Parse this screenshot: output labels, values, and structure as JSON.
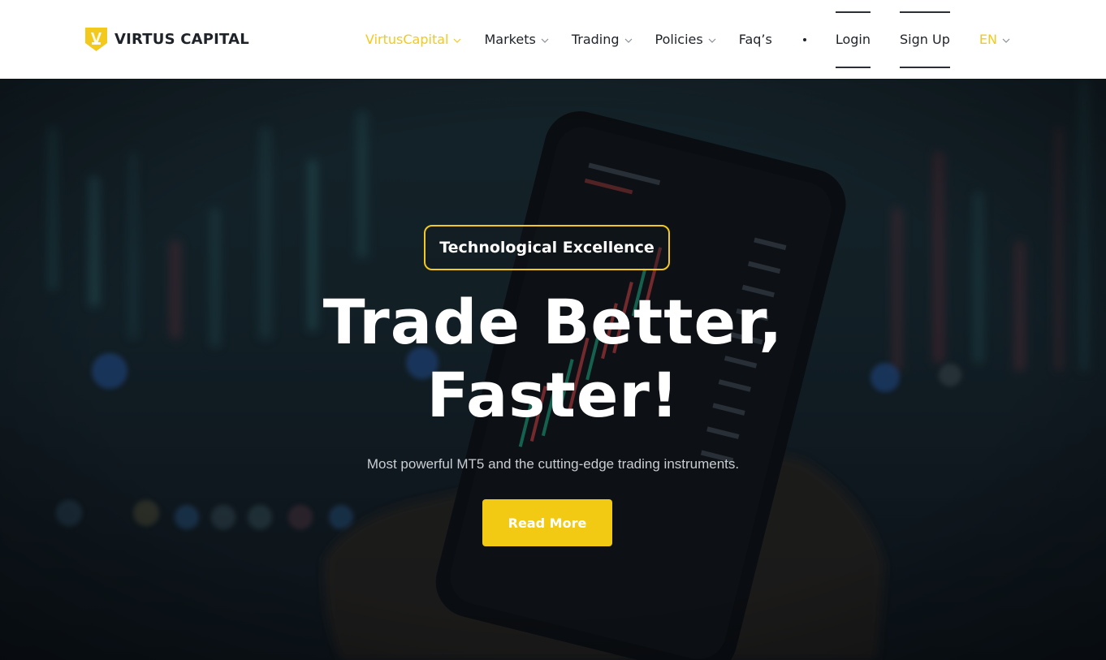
{
  "brand": {
    "name": "VIRTUS CAPITAL"
  },
  "colors": {
    "accent": "#f4c91d",
    "button": "#f2ca14",
    "text_dark": "#1e2229"
  },
  "nav": {
    "items": [
      {
        "label": "VirtusCapital",
        "has_dropdown": true,
        "active": true
      },
      {
        "label": "Markets",
        "has_dropdown": true,
        "active": false
      },
      {
        "label": "Trading",
        "has_dropdown": true,
        "active": false
      },
      {
        "label": "Policies",
        "has_dropdown": true,
        "active": false
      },
      {
        "label": "Faq’s",
        "has_dropdown": false,
        "active": false
      }
    ],
    "login": "Login",
    "signup": "Sign Up",
    "language": "EN"
  },
  "hero": {
    "badge": "Technological Excellence",
    "headline_line1": "Trade Better,",
    "headline_line2": "Faster!",
    "subtitle": "Most powerful MT5 and the cutting-edge trading instruments.",
    "cta_label": "Read More"
  }
}
